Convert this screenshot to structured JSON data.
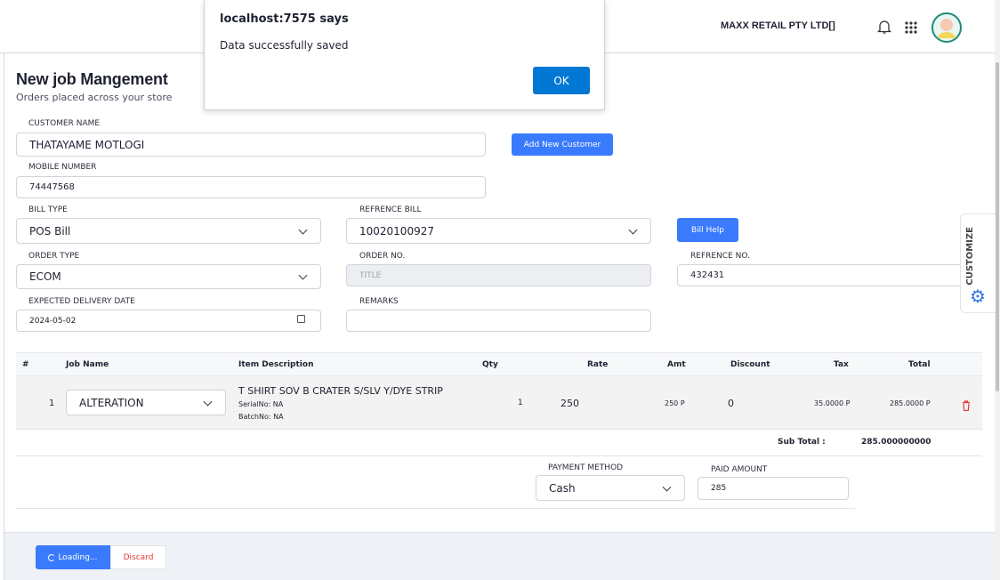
{
  "header": {
    "company": "MAXX RETAIL PTY LTD[]"
  },
  "page": {
    "title": "New job Mangement",
    "subtitle": "Orders placed across your store"
  },
  "form": {
    "customer_name": {
      "label": "CUSTOMER NAME",
      "value": "THATAYAME MOTLOGI"
    },
    "add_customer": "Add New Customer",
    "mobile": {
      "label": "MOBILE NUMBER",
      "value": "74447568"
    },
    "bill_type": {
      "label": "BILL TYPE",
      "value": "POS Bill"
    },
    "ref_bill": {
      "label": "REFRENCE BILL",
      "value": "10020100927"
    },
    "bill_help": "Bill Help",
    "order_type": {
      "label": "ORDER TYPE",
      "value": "ECOM"
    },
    "order_no": {
      "label": "ORDER NO.",
      "placeholder": "TITLE"
    },
    "ref_no": {
      "label": "REFRENCE NO.",
      "value": "432431"
    },
    "delivery": {
      "label": "EXPECTED DELIVERY DATE",
      "value": "2024-05-02"
    },
    "remarks": {
      "label": "REMARKS",
      "value": ""
    }
  },
  "table": {
    "headers": [
      "#",
      "Job Name",
      "Item Description",
      "Qty",
      "Rate",
      "Amt",
      "Discount",
      "Tax",
      "Total"
    ],
    "rows": [
      {
        "num": "1",
        "job": "ALTERATION",
        "desc": "T SHIRT SOV B CRATER S/SLV Y/DYE STRIP",
        "serial": "SerialNo: NA",
        "batch": "BatchNo: NA",
        "qty": "1",
        "rate": "250",
        "amt": "250 P",
        "discount": "0",
        "tax": "35.0000 P",
        "total": "285.0000 P"
      }
    ],
    "subtotal_label": "Sub Total :",
    "subtotal": "285.000000000"
  },
  "payment": {
    "method_label": "PAYMENT METHOD",
    "method": "Cash",
    "paid_label": "PAID AMOUNT",
    "paid": "285"
  },
  "footer": {
    "loading": "Loading...",
    "discard": "Discard"
  },
  "customize": "CUSTOMIZE",
  "dialog": {
    "title": "localhost:7575 says",
    "message": "Data successfully saved",
    "ok": "OK"
  },
  "colors": {
    "primary": "#3a7bfd",
    "dialog_ok": "#0078d4",
    "danger": "#e53935"
  }
}
